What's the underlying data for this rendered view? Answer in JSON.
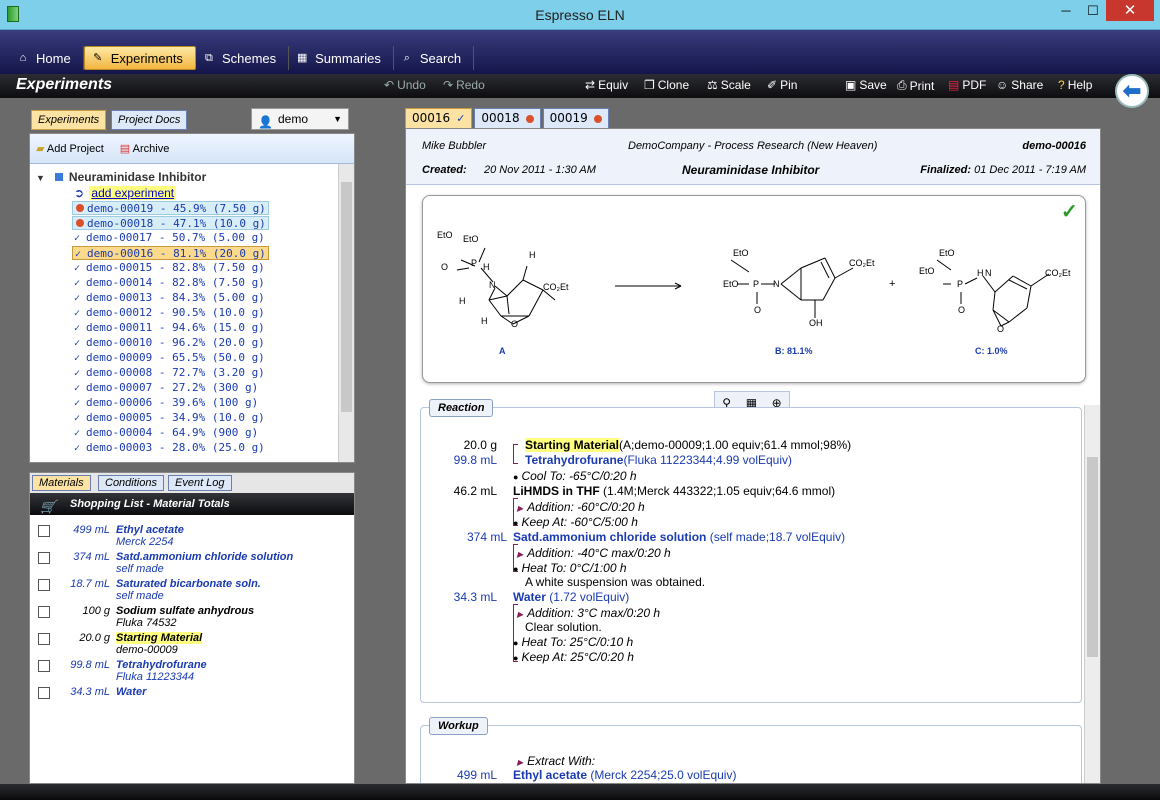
{
  "window": {
    "title": "Espresso ELN",
    "minimize": "─",
    "maximize": "☐",
    "close": "✕"
  },
  "nav": {
    "tabs": [
      {
        "label": "Home",
        "icon": "home-icon"
      },
      {
        "label": "Experiments",
        "icon": "experiments-icon"
      },
      {
        "label": "Schemes",
        "icon": "schemes-icon"
      },
      {
        "label": "Summaries",
        "icon": "summaries-icon"
      },
      {
        "label": "Search",
        "icon": "search-icon"
      }
    ]
  },
  "toolbar": {
    "page_title": "Experiments",
    "undo": "Undo",
    "redo": "Redo",
    "equiv": "Equiv",
    "clone": "Clone",
    "scale": "Scale",
    "pin": "Pin",
    "save": "Save",
    "print": "Print",
    "pdf": "PDF",
    "share": "Share",
    "help": "Help"
  },
  "left": {
    "tabs": [
      "Experiments",
      "Project Docs"
    ],
    "user": "demo",
    "add_project": "Add Project",
    "archive": "Archive",
    "project": "Neuraminidase Inhibitor",
    "add_experiment": "add experiment",
    "experiments": [
      {
        "label": "demo-00019 - 45.9% (7.50 g)",
        "state": "pending"
      },
      {
        "label": "demo-00018 - 47.1% (10.0 g)",
        "state": "pending"
      },
      {
        "label": "demo-00017 - 50.7% (5.00 g)",
        "state": "done"
      },
      {
        "label": "demo-00016 - 81.1% (20.0 g)",
        "state": "selected"
      },
      {
        "label": "demo-00015 - 82.8% (7.50 g)",
        "state": "done"
      },
      {
        "label": "demo-00014 - 82.8% (7.50 g)",
        "state": "done"
      },
      {
        "label": "demo-00013 - 84.3% (5.00 g)",
        "state": "done"
      },
      {
        "label": "demo-00012 - 90.5% (10.0 g)",
        "state": "done"
      },
      {
        "label": "demo-00011 - 94.6% (15.0 g)",
        "state": "done"
      },
      {
        "label": "demo-00010 - 96.2% (20.0 g)",
        "state": "done"
      },
      {
        "label": "demo-00009 - 65.5% (50.0 g)",
        "state": "done"
      },
      {
        "label": "demo-00008 - 72.7% (3.20 g)",
        "state": "done"
      },
      {
        "label": "demo-00007 - 27.2% (300 g)",
        "state": "done"
      },
      {
        "label": "demo-00006 - 39.6% (100 g)",
        "state": "done"
      },
      {
        "label": "demo-00005 - 34.9% (10.0 g)",
        "state": "done"
      },
      {
        "label": "demo-00004 - 64.9% (900 g)",
        "state": "done"
      },
      {
        "label": "demo-00003 - 28.0% (25.0 g)",
        "state": "done"
      }
    ],
    "material_tabs": [
      "Materials",
      "Conditions",
      "Event Log"
    ],
    "shopping_title": "Shopping List - Material Totals",
    "materials": [
      {
        "qty": "499 mL",
        "name": "Ethyl acetate",
        "source": "Merck 2254",
        "color": "blue"
      },
      {
        "qty": "374 mL",
        "name": "Satd.ammonium chloride solution",
        "source": "self made",
        "color": "blue"
      },
      {
        "qty": "18.7 mL",
        "name": "Saturated bicarbonate soln.",
        "source": "self made",
        "color": "blue"
      },
      {
        "qty": "100 g",
        "name": "Sodium sulfate anhydrous",
        "source": "Fluka 74532",
        "color": "black"
      },
      {
        "qty": "20.0 g",
        "name": "Starting Material",
        "source": "demo-00009",
        "color": "black",
        "highlight": true
      },
      {
        "qty": "99.8 mL",
        "name": "Tetrahydrofurane",
        "source": "Fluka 11223344",
        "color": "blue"
      },
      {
        "qty": "34.3 mL",
        "name": "Water",
        "source": "",
        "color": "blue"
      }
    ]
  },
  "main": {
    "tabs": [
      {
        "label": "00016",
        "mark": "✓"
      },
      {
        "label": "00018",
        "mark": "dot"
      },
      {
        "label": "00019",
        "mark": "dot"
      }
    ],
    "header": {
      "author": "Mike Bubbler",
      "company": "DemoCompany - Process Research (New Heaven)",
      "exp_id": "demo-00016",
      "created_label": "Created:",
      "created": "20 Nov 2011 - 1:30 AM",
      "title": "Neuraminidase Inhibitor",
      "finalized_label": "Finalized:",
      "finalized": "01 Dec 2011 - 7:19 AM"
    },
    "scheme": {
      "label_a": "A",
      "label_b": "B: 81.1%",
      "label_c": "C: 1.0%",
      "eto": "EtO",
      "p": "P",
      "o": "O",
      "n": "N",
      "h": "H",
      "oh": "OH",
      "co2et": "CO₂Et",
      "plus": "+"
    },
    "reaction": {
      "title": "Reaction",
      "sm_qty": "20.0 g",
      "sm_name": "Starting Material",
      "sm_detail": "(A;demo-00009;1.00 equiv;61.4 mmol;98%)",
      "thf_qty": "99.8 mL",
      "thf_name": "Tetrahydrofurane",
      "thf_detail": "(Fluka 11223344;4.99 volEquiv)",
      "cool": "Cool To: -65°C/0:20 h",
      "lih_qty": "46.2 mL",
      "lih_name": "LiHMDS in THF",
      "lih_detail": "(1.4M;Merck 443322;1.05 equiv;64.6 mmol)",
      "add1": "Addition: -60°C/0:20 h",
      "keep1": "Keep At: -60°C/5:00 h",
      "nh4_qty": "374 mL",
      "nh4_name": "Satd.ammonium chloride solution",
      "nh4_detail": "(self made;18.7 volEquiv)",
      "add2": "Addition: -40°C max/0:20 h",
      "heat1": "Heat To: 0°C/1:00 h",
      "note1": "A white suspension was obtained.",
      "water_qty": "34.3 mL",
      "water_name": "Water",
      "water_detail": "(1.72 volEquiv)",
      "add3": "Addition: 3°C max/0:20 h",
      "note2": "Clear solution.",
      "heat2": "Heat To: 25°C/0:10 h",
      "keep2": "Keep At: 25°C/0:20 h"
    },
    "workup": {
      "title": "Workup",
      "extract": "Extract With:",
      "ea_qty": "499 mL",
      "ea_name": "Ethyl acetate",
      "ea_detail": "(Merck 2254;25.0 volEquiv)"
    }
  }
}
